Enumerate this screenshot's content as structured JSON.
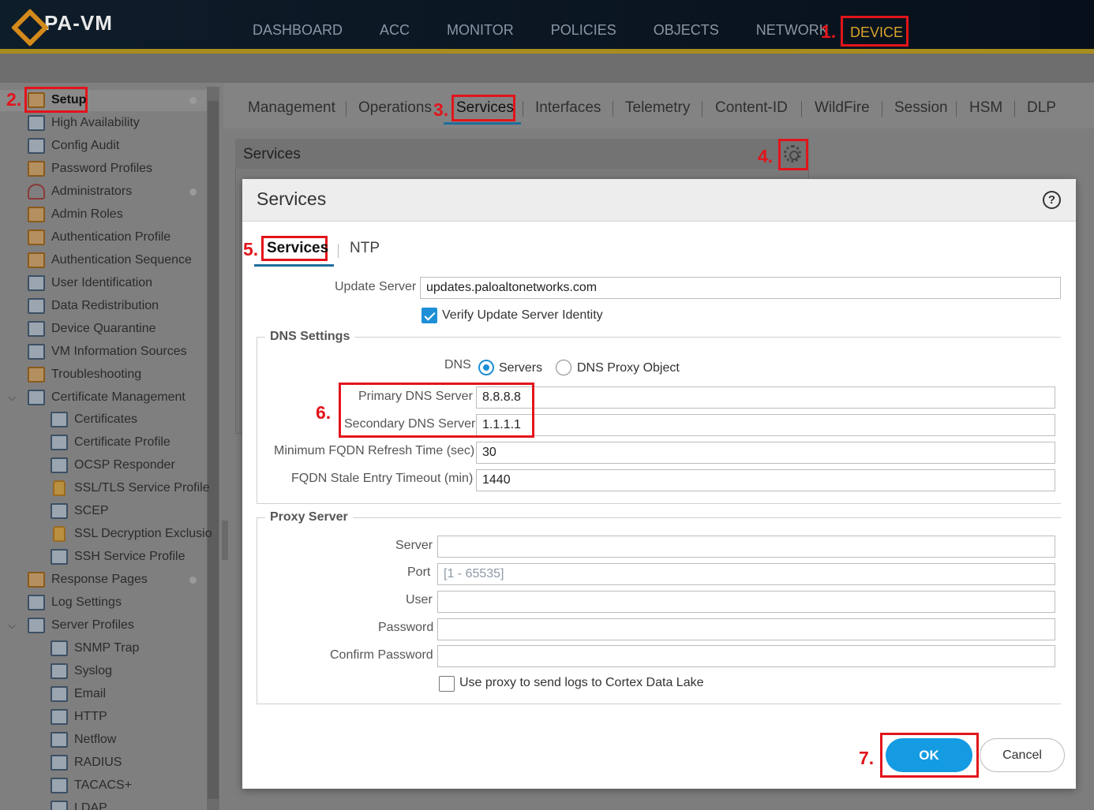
{
  "app": {
    "logo_text": "PA-VM"
  },
  "nav": {
    "items": [
      "DASHBOARD",
      "ACC",
      "MONITOR",
      "POLICIES",
      "OBJECTS",
      "NETWORK"
    ],
    "active": "DEVICE"
  },
  "annotations": [
    "1.",
    "2.",
    "3.",
    "4.",
    "5.",
    "6.",
    "7."
  ],
  "sidebar": {
    "items": [
      "Setup",
      "High Availability",
      "Config Audit",
      "Password Profiles",
      "Administrators",
      "Admin Roles",
      "Authentication Profile",
      "Authentication Sequence",
      "User Identification",
      "Data Redistribution",
      "Device Quarantine",
      "VM Information Sources",
      "Troubleshooting",
      "Certificate Management",
      "Certificates",
      "Certificate Profile",
      "OCSP Responder",
      "SSL/TLS Service Profile",
      "SCEP",
      "SSL Decryption Exclusio",
      "SSH Service Profile",
      "Response Pages",
      "Log Settings",
      "Server Profiles",
      "SNMP Trap",
      "Syslog",
      "Email",
      "HTTP",
      "Netflow",
      "RADIUS",
      "TACACS+",
      "LDAP"
    ]
  },
  "tabs": [
    "Management",
    "Operations",
    "Services",
    "Interfaces",
    "Telemetry",
    "Content-ID",
    "WildFire",
    "Session",
    "HSM",
    "DLP"
  ],
  "panel": {
    "title": "Services"
  },
  "dialog": {
    "title": "Services",
    "help": "?",
    "tabs": [
      "Services",
      "NTP"
    ],
    "update_server_label": "Update Server",
    "update_server_value": "updates.paloaltonetworks.com",
    "verify_label": "Verify Update Server Identity",
    "dns_legend": "DNS Settings",
    "dns_label": "DNS",
    "dns_option_servers": "Servers",
    "dns_option_proxy": "DNS Proxy Object",
    "primary_dns_label": "Primary DNS Server",
    "primary_dns_value": "8.8.8.8",
    "secondary_dns_label": "Secondary DNS Server",
    "secondary_dns_value": "1.1.1.1",
    "fqdn_refresh_label": "Minimum FQDN Refresh Time (sec)",
    "fqdn_refresh_value": "30",
    "fqdn_stale_label": "FQDN Stale Entry Timeout (min)",
    "fqdn_stale_value": "1440",
    "proxy_legend": "Proxy Server",
    "proxy_server_label": "Server",
    "proxy_port_label": "Port",
    "proxy_port_placeholder": "[1 - 65535]",
    "proxy_user_label": "User",
    "proxy_password_label": "Password",
    "proxy_confirm_label": "Confirm Password",
    "cortex_label": "Use proxy to send logs to Cortex Data Lake",
    "ok_label": "OK",
    "cancel_label": "Cancel"
  },
  "colors": {
    "accent": "#149be2",
    "annotation": "#e3141b",
    "nav_active": "#d9a32b"
  }
}
